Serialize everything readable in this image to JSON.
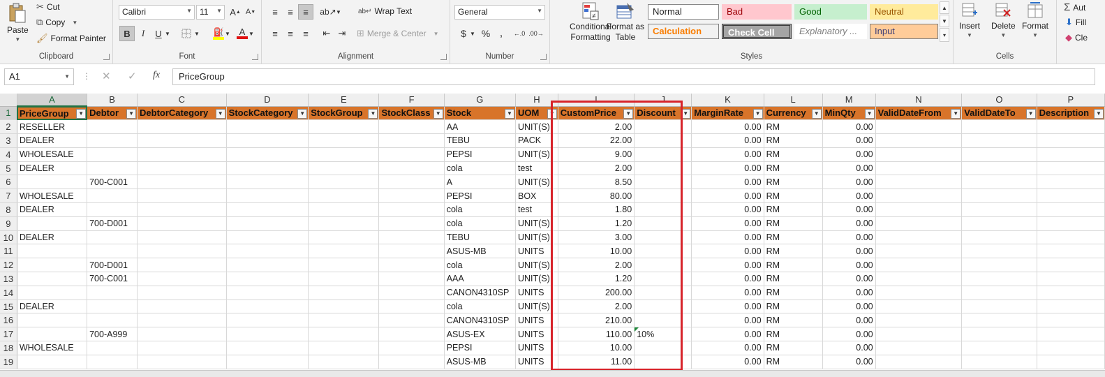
{
  "ribbon": {
    "clipboard": {
      "paste": "Paste",
      "cut": "Cut",
      "copy": "Copy",
      "format_painter": "Format Painter",
      "label": "Clipboard"
    },
    "font": {
      "name": "Calibri",
      "size": "11",
      "label": "Font"
    },
    "alignment": {
      "wrap_text": "Wrap Text",
      "merge_center": "Merge & Center",
      "label": "Alignment"
    },
    "number": {
      "format": "General",
      "label": "Number"
    },
    "styles": {
      "conditional_formatting": "Conditional Formatting",
      "format_as_table": "Format as Table",
      "normal": "Normal",
      "bad": "Bad",
      "good": "Good",
      "neutral": "Neutral",
      "calculation": "Calculation",
      "check_cell": "Check Cell",
      "explanatory": "Explanatory ...",
      "input": "Input",
      "label": "Styles"
    },
    "cells": {
      "insert": "Insert",
      "delete": "Delete",
      "format": "Format",
      "label": "Cells"
    },
    "editing": {
      "autosum": "Aut",
      "fill": "Fill",
      "clear": "Cle"
    }
  },
  "formula_bar": {
    "name_box": "A1",
    "fx": "fx",
    "content": "PriceGroup"
  },
  "grid": {
    "columns": [
      "A",
      "B",
      "C",
      "D",
      "E",
      "F",
      "G",
      "H",
      "I",
      "J",
      "K",
      "L",
      "M",
      "N",
      "O",
      "P"
    ],
    "selected_column": "A",
    "headers": [
      "PriceGroup",
      "Debtor",
      "DebtorCategory",
      "StockCategory",
      "StockGroup",
      "StockClass",
      "Stock",
      "UOM",
      "CustomPrice",
      "Discount",
      "MarginRate",
      "Currency",
      "MinQty",
      "ValidDateFrom",
      "ValidDateTo",
      "Description"
    ],
    "rows": [
      [
        "RESELLER",
        "",
        "",
        "",
        "",
        "",
        "AA",
        "UNIT(S)",
        "2.00",
        "",
        "0.00",
        "RM",
        "0.00",
        "",
        "",
        ""
      ],
      [
        "DEALER",
        "",
        "",
        "",
        "",
        "",
        "TEBU",
        "PACK",
        "22.00",
        "",
        "0.00",
        "RM",
        "0.00",
        "",
        "",
        ""
      ],
      [
        "WHOLESALE",
        "",
        "",
        "",
        "",
        "",
        "PEPSI",
        "UNIT(S)",
        "9.00",
        "",
        "0.00",
        "RM",
        "0.00",
        "",
        "",
        ""
      ],
      [
        "DEALER",
        "",
        "",
        "",
        "",
        "",
        "cola",
        "test",
        "2.00",
        "",
        "0.00",
        "RM",
        "0.00",
        "",
        "",
        ""
      ],
      [
        "",
        "700-C001",
        "",
        "",
        "",
        "",
        "A",
        "UNIT(S)",
        "8.50",
        "",
        "0.00",
        "RM",
        "0.00",
        "",
        "",
        ""
      ],
      [
        "WHOLESALE",
        "",
        "",
        "",
        "",
        "",
        "PEPSI",
        "BOX",
        "80.00",
        "",
        "0.00",
        "RM",
        "0.00",
        "",
        "",
        ""
      ],
      [
        "DEALER",
        "",
        "",
        "",
        "",
        "",
        "cola",
        "test",
        "1.80",
        "",
        "0.00",
        "RM",
        "0.00",
        "",
        "",
        ""
      ],
      [
        "",
        "700-D001",
        "",
        "",
        "",
        "",
        "cola",
        "UNIT(S)",
        "1.20",
        "",
        "0.00",
        "RM",
        "0.00",
        "",
        "",
        ""
      ],
      [
        "DEALER",
        "",
        "",
        "",
        "",
        "",
        "TEBU",
        "UNIT(S)",
        "3.00",
        "",
        "0.00",
        "RM",
        "0.00",
        "",
        "",
        ""
      ],
      [
        "",
        "",
        "",
        "",
        "",
        "",
        "ASUS-MB",
        "UNITS",
        "10.00",
        "",
        "0.00",
        "RM",
        "0.00",
        "",
        "",
        ""
      ],
      [
        "",
        "700-D001",
        "",
        "",
        "",
        "",
        "cola",
        "UNIT(S)",
        "2.00",
        "",
        "0.00",
        "RM",
        "0.00",
        "",
        "",
        ""
      ],
      [
        "",
        "700-C001",
        "",
        "",
        "",
        "",
        "AAA",
        "UNIT(S)",
        "1.20",
        "",
        "0.00",
        "RM",
        "0.00",
        "",
        "",
        ""
      ],
      [
        "",
        "",
        "",
        "",
        "",
        "",
        "CANON4310SP",
        "UNITS",
        "200.00",
        "",
        "0.00",
        "RM",
        "0.00",
        "",
        "",
        ""
      ],
      [
        "DEALER",
        "",
        "",
        "",
        "",
        "",
        "cola",
        "UNIT(S)",
        "2.00",
        "",
        "0.00",
        "RM",
        "0.00",
        "",
        "",
        ""
      ],
      [
        "",
        "",
        "",
        "",
        "",
        "",
        "CANON4310SP",
        "UNITS",
        "210.00",
        "",
        "0.00",
        "RM",
        "0.00",
        "",
        "",
        ""
      ],
      [
        "",
        "700-A999",
        "",
        "",
        "",
        "",
        "ASUS-EX",
        "UNITS",
        "110.00",
        "10%",
        "0.00",
        "RM",
        "0.00",
        "",
        "",
        ""
      ],
      [
        "WHOLESALE",
        "",
        "",
        "",
        "",
        "",
        "PEPSI",
        "UNITS",
        "10.00",
        "",
        "0.00",
        "RM",
        "0.00",
        "",
        "",
        ""
      ],
      [
        "",
        "",
        "",
        "",
        "",
        "",
        "ASUS-MB",
        "UNITS",
        "11.00",
        "",
        "0.00",
        "RM",
        "0.00",
        "",
        "",
        ""
      ]
    ],
    "numeric_columns": [
      8,
      10,
      12
    ]
  },
  "colors": {
    "header_fill": "#d8742a",
    "highlight_box": "#d7242b",
    "selection": "#217346"
  }
}
